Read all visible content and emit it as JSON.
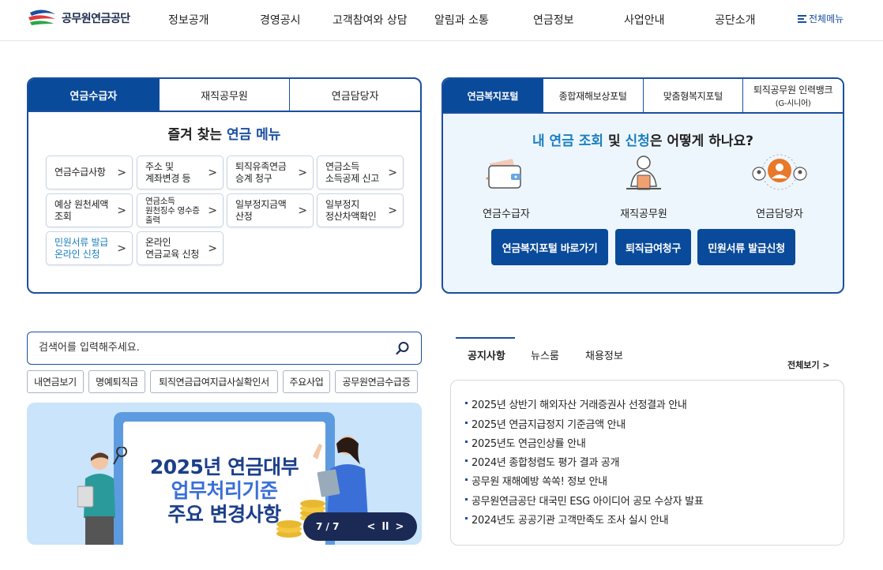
{
  "header": {
    "logo_text": "공무원연금공단",
    "nav": [
      "정보공개",
      "경영공시",
      "고객참여와 상담",
      "알림과 소통",
      "연금정보",
      "사업안내",
      "공단소개"
    ],
    "all_menu": "전체메뉴"
  },
  "left_panel": {
    "tabs": [
      "연금수급자",
      "재직공무원",
      "연금담당자"
    ],
    "title_prefix": "즐겨 찾는",
    "title_highlight": "연금 메뉴",
    "menu": [
      "연금수급사항",
      "주소 및\n계좌변경 등",
      "퇴직유족연금\n승계 청구",
      "연금소득\n소득공제 신고",
      "예상 원천세액\n조회",
      "연금소득\n원천징수 영수증\n출력",
      "일부정지금액\n산정",
      "일부정지\n정산차액확인",
      "민원서류 발급\n온라인 신청",
      "온라인\n연금교육 신청"
    ]
  },
  "right_panel": {
    "tabs": [
      "연금복지포털",
      "종합재해보상포털",
      "맞춤형복지포털"
    ],
    "tab4_title": "퇴직공무원 인력뱅크",
    "tab4_sub": "(G-시니어)",
    "title_hl1": "내 연금 조회",
    "title_mid": " 및 ",
    "title_hl2": "신청",
    "title_suffix": "은 어떻게 하나요?",
    "roles": [
      "연금수급자",
      "재직공무원",
      "연금담당자"
    ],
    "buttons": [
      "연금복지포털 바로가기",
      "퇴직급여청구",
      "민원서류 발급신청"
    ]
  },
  "search": {
    "placeholder": "검색어를 입력해주세요.",
    "tags": [
      "내연금보기",
      "명예퇴직금",
      "퇴직연금급여지급사실확인서",
      "주요사업",
      "공무원연금수급증"
    ]
  },
  "banner": {
    "line1": "2025년 연금대부",
    "line2": "업무처리기준",
    "line3": "주요 변경사항",
    "counter": "7 / 7",
    "colors": {
      "title": "#1b3f8a",
      "accent": "#3a6fd8",
      "bg": "#c9e4fb"
    }
  },
  "news": {
    "tabs": [
      "공지사항",
      "뉴스룸",
      "채용정보"
    ],
    "more": "전체보기",
    "items": [
      "2025년 상반기 해외자산 거래증권사 선정결과 안내",
      "2025년 연금지급정지 기준금액 안내",
      "2025년도 연금인상률 안내",
      "2024년 종합청렴도 평가 결과 공개",
      "공무원 재해예방 쏙쏙! 정보 안내",
      "공무원연금공단 대국민 ESG 아이디어 공모 수상자 발표",
      "2024년도 공공기관 고객만족도 조사 실시 안내"
    ]
  },
  "colors": {
    "primary": "#0a4a9a",
    "light_blue": "#1a7fc0",
    "panel_bg": "#eef6fd"
  }
}
